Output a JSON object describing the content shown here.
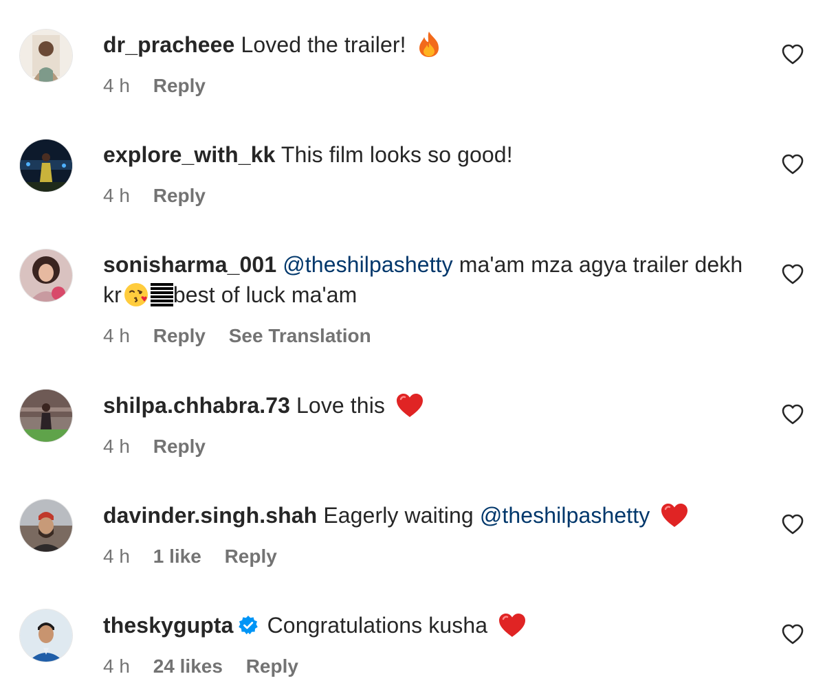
{
  "comments": [
    {
      "username": "dr_pracheee",
      "text": "Loved the trailer!",
      "emoji": "fire",
      "time": "4 h",
      "reply": "Reply",
      "avatar_colors": [
        "#f2ede6",
        "#b49a7e"
      ]
    },
    {
      "username": "explore_with_kk",
      "text": "This film looks so good!",
      "time": "4 h",
      "reply": "Reply",
      "avatar_colors": [
        "#0d1a2c",
        "#c9b33b"
      ]
    },
    {
      "username": "sonisharma_001",
      "mention": "@theshilpashetty",
      "text_part1": "ma'am mza agya trailer dekh kr",
      "emoji": "kissing-face",
      "text_part2": "best of luck ma'am",
      "time": "4 h",
      "reply": "Reply",
      "see_translation": "See Translation",
      "avatar_colors": [
        "#c89aa0",
        "#5a3a2e"
      ]
    },
    {
      "username": "shilpa.chhabra.73",
      "text": "Love this",
      "emoji": "red-heart",
      "time": "4 h",
      "reply": "Reply",
      "avatar_colors": [
        "#6e5a55",
        "#5fa34a"
      ]
    },
    {
      "username": "davinder.singh.shah",
      "text": "Eagerly waiting",
      "mention": "@theshilpashetty",
      "emoji": "red-heart",
      "time": "4 h",
      "likes": "1 like",
      "reply": "Reply",
      "avatar_colors": [
        "#b9bcc1",
        "#c0392b"
      ]
    },
    {
      "username": "theskygupta",
      "verified": true,
      "text": "Congratulations kusha",
      "emoji": "red-heart",
      "time": "4 h",
      "likes": "24 likes",
      "reply": "Reply",
      "avatar_colors": [
        "#dfe9f0",
        "#1f5ea8"
      ]
    }
  ],
  "colors": {
    "text": "#262626",
    "secondary": "#737373",
    "mention": "#00376b",
    "verified": "#0095f6",
    "heart_emoji": "#e02424"
  }
}
